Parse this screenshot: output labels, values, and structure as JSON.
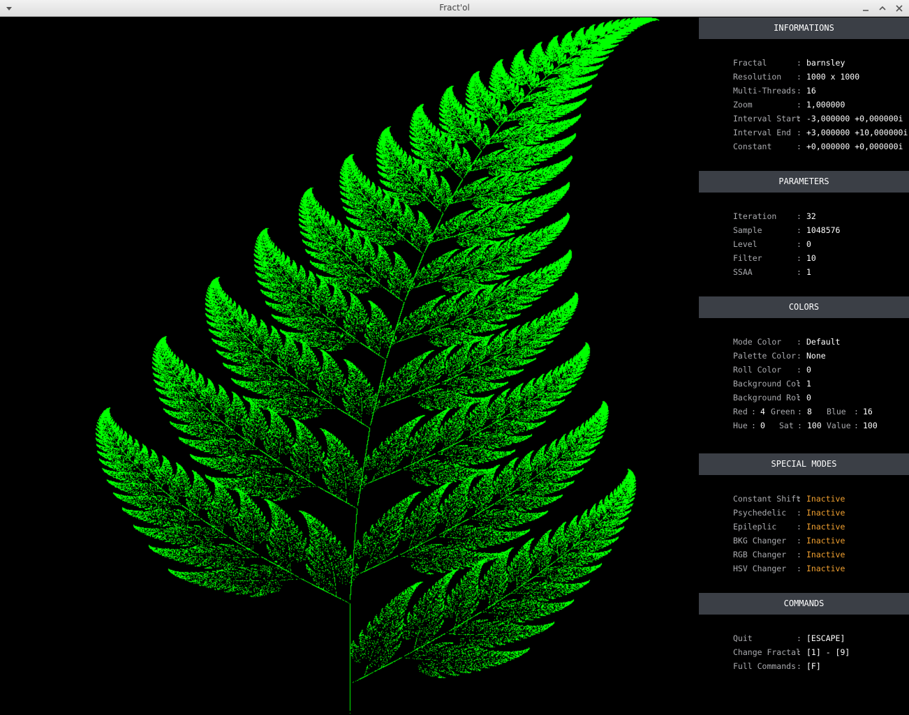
{
  "window": {
    "title": "Fract'ol"
  },
  "panel": {
    "informations": {
      "header": "INFORMATIONS",
      "rows": [
        {
          "label": "Fractal",
          "value": "barnsley"
        },
        {
          "label": "Resolution",
          "value": "1000 x 1000"
        },
        {
          "label": "Multi-Threads",
          "value": "16"
        },
        {
          "label": "Zoom",
          "value": "1,000000"
        },
        {
          "label": "Interval Start",
          "value": "-3,000000 +0,000000i"
        },
        {
          "label": "Interval End",
          "value": "+3,000000 +10,000000i"
        },
        {
          "label": "Constant",
          "value": "+0,000000 +0,000000i"
        }
      ]
    },
    "parameters": {
      "header": "PARAMETERS",
      "rows": [
        {
          "label": "Iteration",
          "value": "32"
        },
        {
          "label": "Sample",
          "value": "1048576"
        },
        {
          "label": "Level",
          "value": "0"
        },
        {
          "label": "Filter",
          "value": "10"
        },
        {
          "label": "SSAA",
          "value": "1"
        }
      ]
    },
    "colors": {
      "header": "COLORS",
      "rows": [
        {
          "label": "Mode Color",
          "value": "Default"
        },
        {
          "label": "Palette Color",
          "value": "None"
        },
        {
          "label": "Roll Color",
          "value": "0"
        },
        {
          "label": "Background Col",
          "value": "1"
        },
        {
          "label": "Background Rol",
          "value": "0"
        }
      ],
      "rgb": {
        "red_label": "Red",
        "red": "4",
        "green_label": "Green",
        "green": "8",
        "blue_label": "Blue",
        "blue": "16"
      },
      "hsv": {
        "hue_label": "Hue",
        "hue": "0",
        "sat_label": "Sat",
        "sat": "100",
        "value_label": "Value",
        "value": "100"
      }
    },
    "special_modes": {
      "header": "SPECIAL MODES",
      "rows": [
        {
          "label": "Constant Shift",
          "value": "Inactive"
        },
        {
          "label": "Psychedelic",
          "value": "Inactive"
        },
        {
          "label": "Epileplic",
          "value": "Inactive"
        },
        {
          "label": "BKG Changer",
          "value": "Inactive"
        },
        {
          "label": "RGB Changer",
          "value": "Inactive"
        },
        {
          "label": "HSV Changer",
          "value": "Inactive"
        }
      ]
    },
    "commands": {
      "header": "COMMANDS",
      "rows": [
        {
          "label": "Quit",
          "value": "[ESCAPE]"
        },
        {
          "label": "Change Fractal",
          "value": "[1] - [9]"
        },
        {
          "label": "Full Commands",
          "value": "[F]"
        }
      ]
    }
  },
  "colors": {
    "fern": "#00ff00",
    "inactive": "#f0a030",
    "header_bg": "#3b3f46",
    "label": "#a9aaae"
  }
}
